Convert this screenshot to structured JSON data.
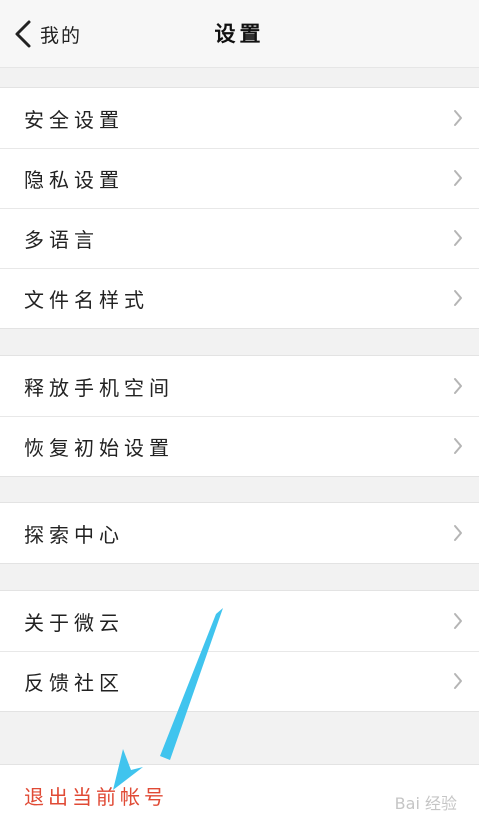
{
  "header": {
    "back_label": "我的",
    "title": "设置"
  },
  "group1": [
    {
      "label": "安全设置"
    },
    {
      "label": "隐私设置"
    },
    {
      "label": "多语言"
    },
    {
      "label": "文件名样式"
    }
  ],
  "group2": [
    {
      "label": "释放手机空间"
    },
    {
      "label": "恢复初始设置"
    }
  ],
  "group3": [
    {
      "label": "探索中心"
    }
  ],
  "group4": [
    {
      "label": "关于微云"
    },
    {
      "label": "反馈社区"
    }
  ],
  "logout": {
    "label": "退出当前帐号"
  },
  "watermark": {
    "text": "Bai 经验"
  },
  "colors": {
    "logout_text": "#e04a35",
    "annotation_arrow": "#40c4ee"
  },
  "icons": {
    "back": "chevron-left-icon",
    "row": "chevron-right-icon"
  }
}
